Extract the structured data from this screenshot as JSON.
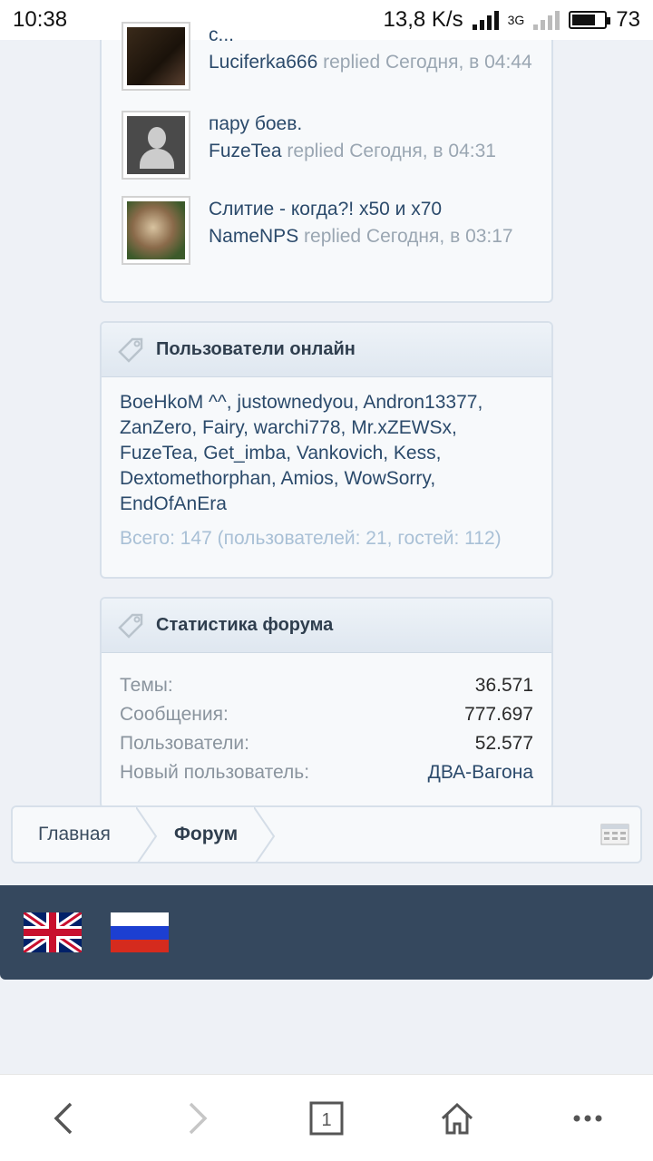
{
  "status_bar": {
    "time": "10:38",
    "speed": "13,8 K/s",
    "network": "3G",
    "battery": "73"
  },
  "threads": [
    {
      "title": "с...",
      "user": "Luciferka666",
      "meta": "replied Сегодня, в 04:44",
      "avatar": "cat-avatar-dark"
    },
    {
      "title": "пару боев.",
      "user": "FuzeTea",
      "meta": "replied Сегодня, в 04:31",
      "avatar": "default-avatar"
    },
    {
      "title": "Слитие - когда?! х50 и х70",
      "user": "NameNPS",
      "meta": "replied Сегодня, в 03:17",
      "avatar": "kitten-avatar"
    }
  ],
  "online": {
    "title": "Пользователи онлайн",
    "users": "BoeHkoM ^^, justownedyou, Andron13377, ZanZero, Fairy, warchi778, Mr.xZEWSx, FuzeTea, Get_imba, Vankovich, Kess, Dextomethorphan, Amios, WowSorry, EndOfAnEra",
    "total": "Всего: 147 (пользователей: 21, гостей: 112)"
  },
  "stats": {
    "title": "Статистика форума",
    "rows": [
      {
        "label": "Темы:",
        "value": "36.571"
      },
      {
        "label": "Сообщения:",
        "value": "777.697"
      },
      {
        "label": "Пользователи:",
        "value": "52.577"
      },
      {
        "label": "Новый пользователь:",
        "value": "ДВА-Вагона"
      }
    ]
  },
  "breadcrumb": {
    "home": "Главная",
    "forum": "Форум"
  },
  "footer": {
    "flags": [
      "uk-flag",
      "russia-flag"
    ]
  },
  "browser": {
    "tab_count": "1"
  },
  "colors": {
    "link": "#2b4a6b",
    "footer_bg": "#35485e",
    "muted": "#9aa6b2"
  }
}
